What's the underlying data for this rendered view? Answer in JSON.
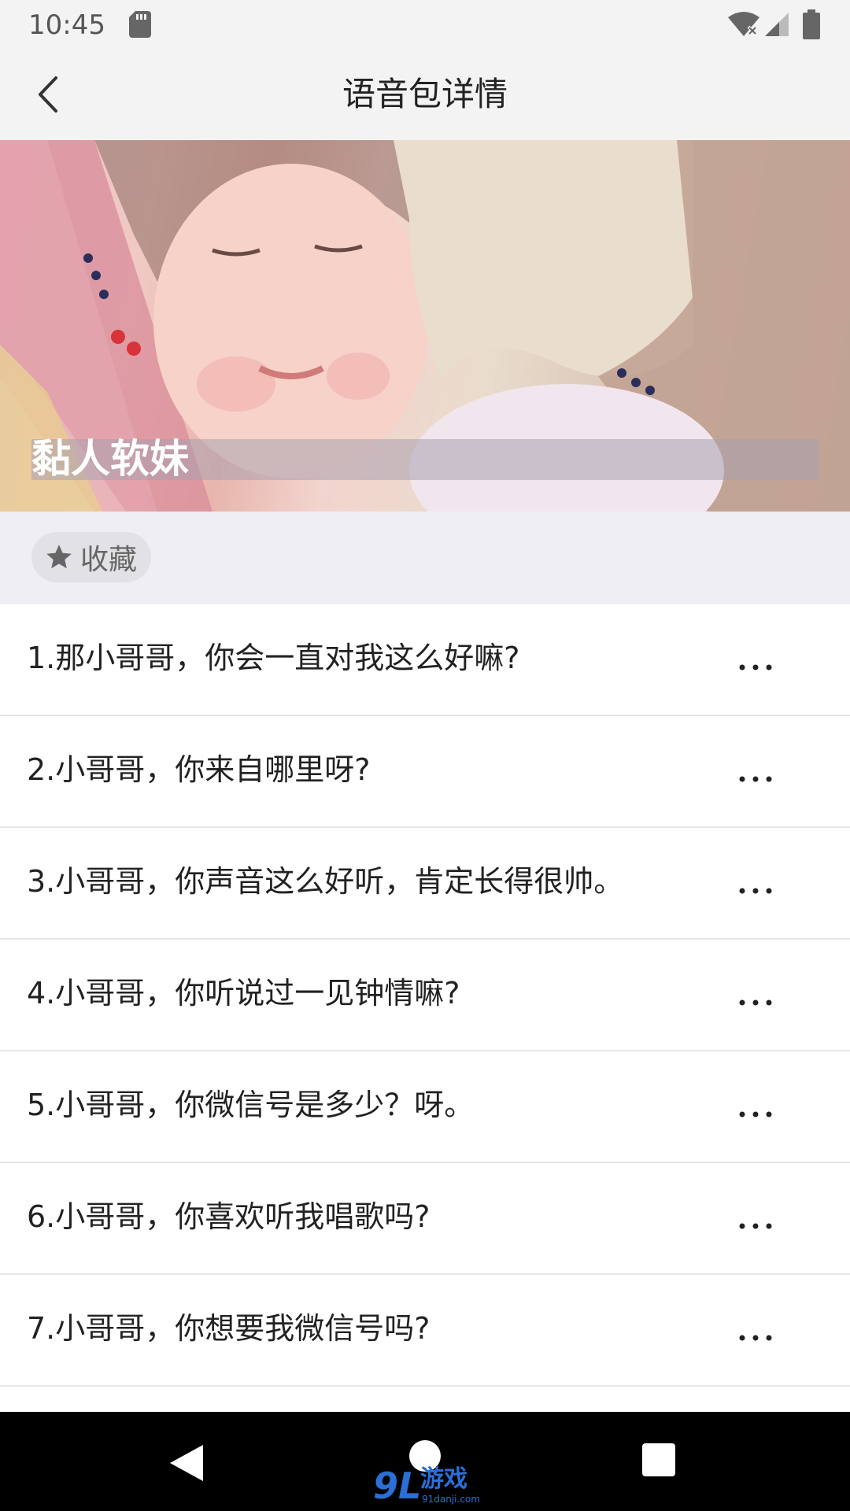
{
  "status_bar": {
    "time": "10:45"
  },
  "header": {
    "title": "语音包详情",
    "back_icon": "chevron-left-icon"
  },
  "cover": {
    "caption": "黏人软妹"
  },
  "favorite": {
    "label": "收藏",
    "icon": "star-icon"
  },
  "voice_list": {
    "more_icon": "ellipsis-icon",
    "items": [
      {
        "label": "1.那小哥哥，你会一直对我这么好嘛?"
      },
      {
        "label": "2.小哥哥，你来自哪里呀?"
      },
      {
        "label": "3.小哥哥，你声音这么好听，肯定长得很帅。"
      },
      {
        "label": "4.小哥哥，你听说过一见钟情嘛?"
      },
      {
        "label": "5.小哥哥，你微信号是多少？呀。"
      },
      {
        "label": "6.小哥哥，你喜欢听我唱歌吗?"
      },
      {
        "label": "7.小哥哥，你想要我微信号吗?"
      }
    ]
  },
  "watermark": {
    "logo": "9L",
    "name": "游戏",
    "url": "91danji.com"
  },
  "colors": {
    "bar_bg": "#f3f3f3",
    "section_bg": "#efeff3",
    "divider": "#e6e6e6",
    "nav_bg": "#000000",
    "watermark": "#2a6fd6"
  }
}
